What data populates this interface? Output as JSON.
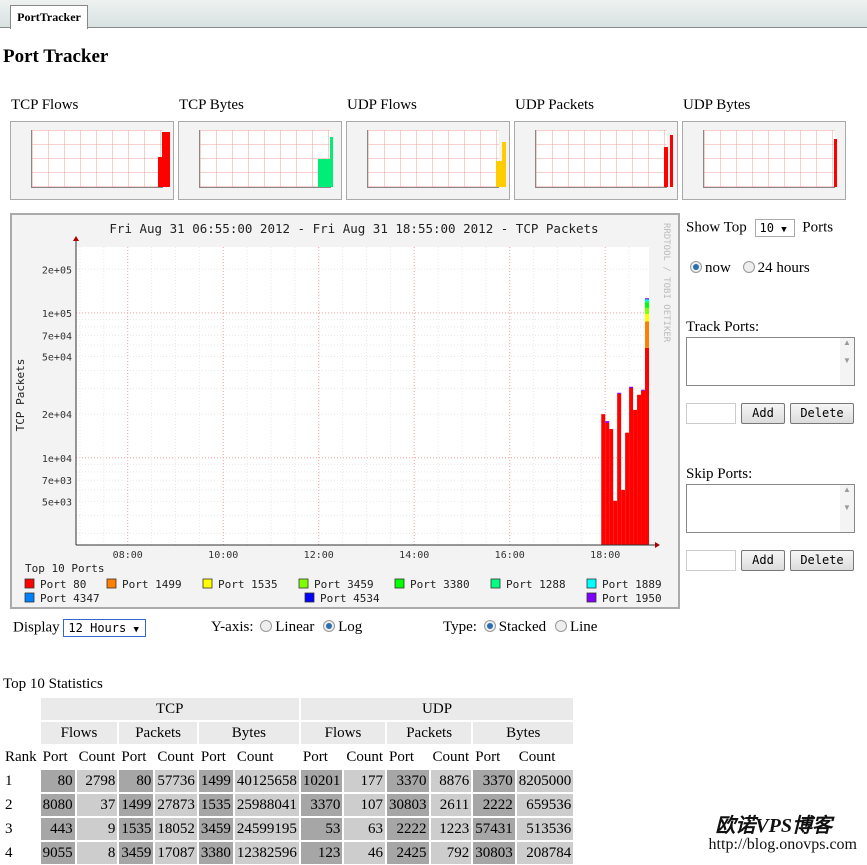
{
  "tab": {
    "label": "PortTracker"
  },
  "page_title": "Port Tracker",
  "thumbnails": [
    {
      "label": "TCP Flows"
    },
    {
      "label": "TCP Bytes"
    },
    {
      "label": "UDP Flows"
    },
    {
      "label": "UDP Packets"
    },
    {
      "label": "UDP Bytes"
    }
  ],
  "chart_data": {
    "type": "bar",
    "stacked": true,
    "title": "Fri Aug 31 06:55:00 2012 - Fri Aug 31 18:55:00 2012 - TCP Packets",
    "ylabel": "TCP Packets",
    "watermark": "RRDTOOL / TOBI OETIKER",
    "yscale": "log",
    "ylim": [
      2500,
      285000
    ],
    "xrange": [
      "06:55",
      "18:55"
    ],
    "x_ticks": [
      "08:00",
      "10:00",
      "12:00",
      "14:00",
      "16:00",
      "18:00"
    ],
    "y_ticks": [
      "2e+05",
      "1e+05",
      "7e+04",
      "5e+04",
      "2e+04",
      "1e+04",
      "7e+03",
      "5e+03"
    ],
    "grid": true,
    "legend_title": "Top 10 Ports",
    "legend_position": "bottom",
    "x": [
      "17:55",
      "18:00",
      "18:05",
      "18:10",
      "18:15",
      "18:20",
      "18:25",
      "18:30",
      "18:35",
      "18:40",
      "18:45",
      "18:50"
    ],
    "series": [
      {
        "name": "Port 80",
        "color": "#ff0000",
        "values": [
          20000,
          17400,
          15800,
          5050,
          27600,
          6000,
          14900,
          30300,
          21400,
          27200,
          29000,
          57300
        ]
      },
      {
        "name": "Port 1499",
        "color": "#ff7f00",
        "values": [
          0,
          0,
          0,
          0,
          0,
          0,
          0,
          0,
          0,
          0,
          0,
          30000
        ]
      },
      {
        "name": "Port 1535",
        "color": "#ffff00",
        "values": [
          0,
          0,
          0,
          0,
          0,
          0,
          0,
          0,
          0,
          0,
          0,
          11000
        ]
      },
      {
        "name": "Port 3459",
        "color": "#80ff00",
        "values": [
          0,
          0,
          0,
          0,
          0,
          0,
          0,
          0,
          0,
          0,
          0,
          10000
        ]
      },
      {
        "name": "Port 3380",
        "color": "#00ff00",
        "values": [
          0,
          0,
          0,
          0,
          0,
          0,
          0,
          0,
          0,
          0,
          0,
          10000
        ]
      },
      {
        "name": "Port 1288",
        "color": "#00ff80",
        "values": [
          0,
          0,
          0,
          0,
          0,
          0,
          0,
          0,
          0,
          0,
          0,
          2500
        ]
      },
      {
        "name": "Port 1889",
        "color": "#00ffff",
        "values": [
          0,
          0,
          0,
          0,
          0,
          0,
          0,
          0,
          0,
          0,
          0,
          2500
        ]
      },
      {
        "name": "Port 4347",
        "color": "#0080ff",
        "values": [
          0,
          0,
          0,
          0,
          0,
          0,
          0,
          0,
          0,
          0,
          0,
          1500
        ]
      },
      {
        "name": "Port 4534",
        "color": "#0000ff",
        "values": [
          0,
          0,
          0,
          0,
          0,
          0,
          0,
          0,
          0,
          0,
          0,
          0
        ]
      },
      {
        "name": "Port 1950",
        "color": "#8000ff",
        "values": [
          0,
          500,
          0,
          0,
          500,
          0,
          0,
          600,
          0,
          0,
          500,
          1500
        ]
      }
    ]
  },
  "controls": {
    "show_top_prefix": "Show Top",
    "show_top_value": "10",
    "show_top_suffix": "Ports",
    "now_label": "now",
    "hours24_label": "24 hours",
    "track_label": "Track Ports:",
    "skip_label": "Skip Ports:",
    "add_label": "Add",
    "delete_label": "Delete",
    "display_label": "Display",
    "display_value": "12 Hours",
    "yaxis_label": "Y-axis:",
    "linear_label": "Linear",
    "log_label": "Log",
    "type_label": "Type:",
    "stacked_label": "Stacked",
    "line_label": "Line"
  },
  "stats": {
    "title": "Top 10 Statistics",
    "groups": [
      "TCP",
      "UDP"
    ],
    "metrics": [
      "Flows",
      "Packets",
      "Bytes"
    ],
    "rank_label": "Rank",
    "port_label": "Port",
    "count_label": "Count",
    "rows": [
      [
        "1",
        "80",
        "2798",
        "80",
        "57736",
        "1499",
        "40125658",
        "10201",
        "177",
        "3370",
        "8876",
        "3370",
        "8205000"
      ],
      [
        "2",
        "8080",
        "37",
        "1499",
        "27873",
        "1535",
        "25988041",
        "3370",
        "107",
        "30803",
        "2611",
        "2222",
        "659536"
      ],
      [
        "3",
        "443",
        "9",
        "1535",
        "18052",
        "3459",
        "24599195",
        "53",
        "63",
        "2222",
        "1223",
        "57431",
        "513536"
      ],
      [
        "4",
        "9055",
        "8",
        "3459",
        "17087",
        "3380",
        "12382596",
        "123",
        "46",
        "2425",
        "792",
        "30803",
        "208784"
      ]
    ]
  },
  "watermark": {
    "brand": "欧诺VPS博客",
    "url": "http://blog.onovps.com"
  }
}
